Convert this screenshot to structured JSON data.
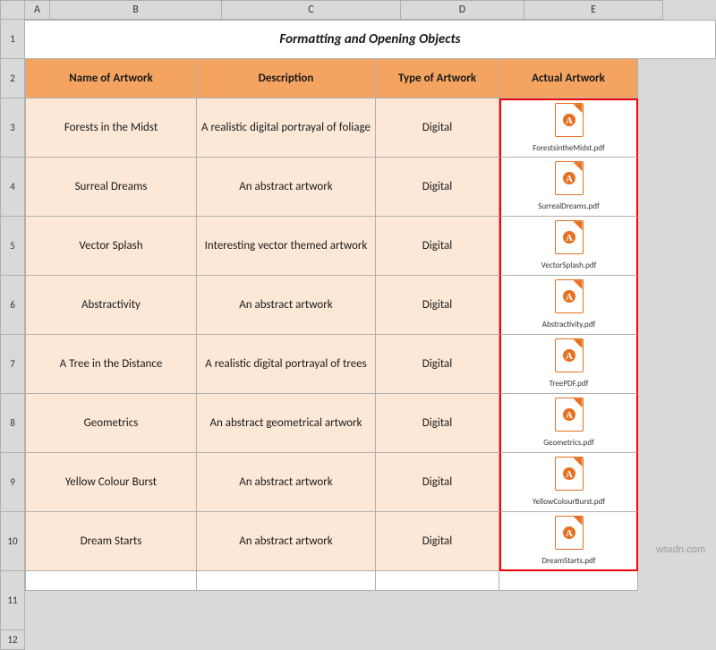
{
  "title": "Formatting and Opening Objects",
  "columns": {
    "headers": [
      "Name of Artwork",
      "Description",
      "Type of Artwork",
      "Actual Artwork"
    ],
    "col_labels": [
      "A",
      "B",
      "C",
      "D",
      "E"
    ]
  },
  "rows": [
    {
      "name": "Forests in the Midst",
      "description": "A realistic digital portrayal of  foliage",
      "type": "Digital",
      "filename": "ForestsintheMidst.pdf"
    },
    {
      "name": "Surreal Dreams",
      "description": "An abstract artwork",
      "type": "Digital",
      "filename": "SurrealDreams.pdf"
    },
    {
      "name": "Vector Splash",
      "description": "Interesting vector themed artwork",
      "type": "Digital",
      "filename": "VectorSplash.pdf"
    },
    {
      "name": "Abstractivity",
      "description": "An abstract artwork",
      "type": "Digital",
      "filename": "Abstractivity.pdf"
    },
    {
      "name": "A Tree in the Distance",
      "description": "A realistic digital portrayal of trees",
      "type": "Digital",
      "filename": "TreePDF.pdf"
    },
    {
      "name": "Geometrics",
      "description": "An abstract geometrical artwork",
      "type": "Digital",
      "filename": "Geometrics.pdf"
    },
    {
      "name": "Yellow Colour Burst",
      "description": "An abstract artwork",
      "type": "Digital",
      "filename": "YellowColourBurst.pdf"
    },
    {
      "name": "Dream Starts",
      "description": "An abstract artwork",
      "type": "Digital",
      "filename": "DreamStarts.pdf"
    }
  ],
  "row_numbers": [
    "1",
    "2",
    "3",
    "4",
    "5",
    "6",
    "7",
    "8",
    "9",
    "10",
    "11",
    "12"
  ],
  "watermark": "wsxdn.com"
}
